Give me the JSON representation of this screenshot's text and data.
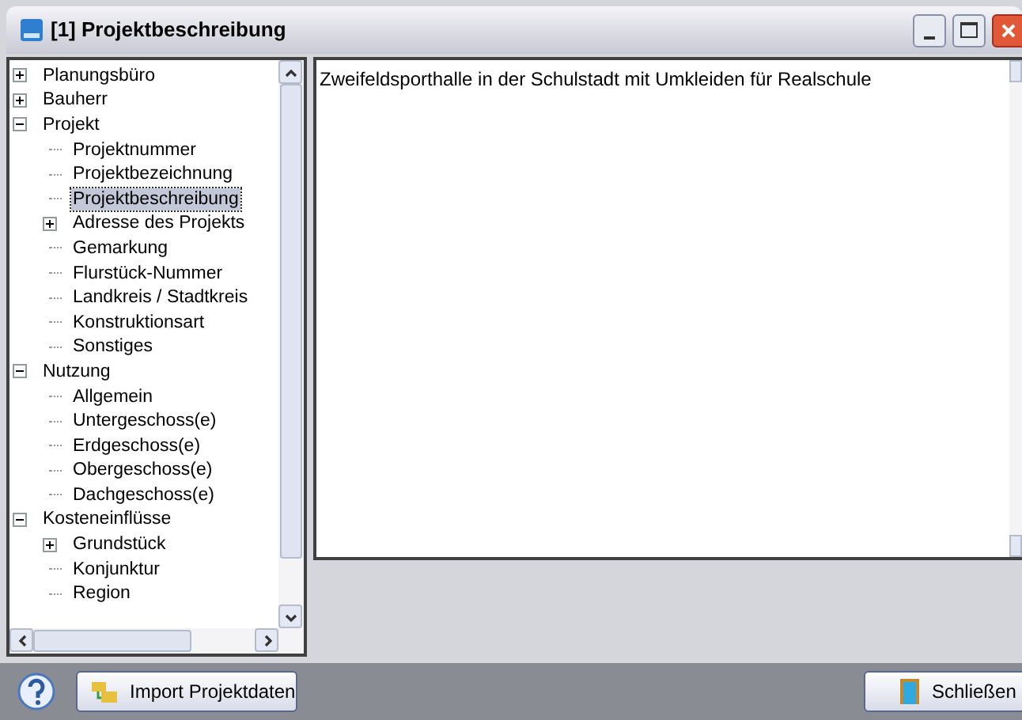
{
  "window": {
    "title": "[1] Projektbeschreibung"
  },
  "tree": [
    {
      "label": "Planungsbüro",
      "kind": "group",
      "expanded": false,
      "selected": false
    },
    {
      "label": "Bauherr",
      "kind": "group",
      "expanded": false,
      "selected": false
    },
    {
      "label": "Projekt",
      "kind": "group",
      "expanded": true,
      "selected": false,
      "children": [
        {
          "label": "Projektnummer",
          "kind": "leaf",
          "selected": false
        },
        {
          "label": "Projektbezeichnung",
          "kind": "leaf",
          "selected": false
        },
        {
          "label": "Projektbeschreibung",
          "kind": "leaf",
          "selected": true
        },
        {
          "label": "Adresse des Projekts",
          "kind": "group",
          "expanded": false,
          "selected": false
        },
        {
          "label": "Gemarkung",
          "kind": "leaf",
          "selected": false
        },
        {
          "label": "Flurstück-Nummer",
          "kind": "leaf",
          "selected": false
        },
        {
          "label": "Landkreis / Stadtkreis",
          "kind": "leaf",
          "selected": false
        },
        {
          "label": "Konstruktionsart",
          "kind": "leaf",
          "selected": false
        },
        {
          "label": "Sonstiges",
          "kind": "leaf",
          "selected": false
        }
      ]
    },
    {
      "label": "Nutzung",
      "kind": "group",
      "expanded": true,
      "selected": false,
      "children": [
        {
          "label": "Allgemein",
          "kind": "leaf",
          "selected": false
        },
        {
          "label": "Untergeschoss(e)",
          "kind": "leaf",
          "selected": false
        },
        {
          "label": "Erdgeschoss(e)",
          "kind": "leaf",
          "selected": false
        },
        {
          "label": "Obergeschoss(e)",
          "kind": "leaf",
          "selected": false
        },
        {
          "label": "Dachgeschoss(e)",
          "kind": "leaf",
          "selected": false
        }
      ]
    },
    {
      "label": "Kosteneinflüsse",
      "kind": "group",
      "expanded": true,
      "selected": false,
      "children": [
        {
          "label": "Grundstück",
          "kind": "group",
          "expanded": false,
          "selected": false
        },
        {
          "label": "Konjunktur",
          "kind": "leaf",
          "selected": false
        },
        {
          "label": "Region",
          "kind": "leaf",
          "selected": false
        }
      ]
    }
  ],
  "description": "Zweifeldsporthalle in der Schulstadt mit Umkleiden für Realschule",
  "buttons": [
    {
      "kind": "import",
      "label": "Import Projektdaten"
    },
    {
      "kind": "close",
      "label": "Schließen"
    }
  ]
}
